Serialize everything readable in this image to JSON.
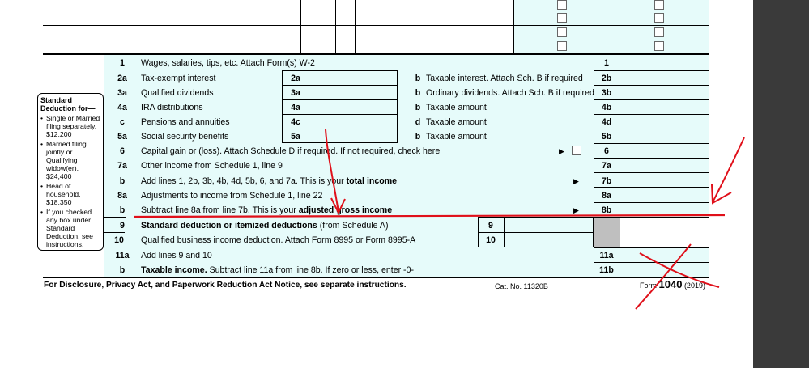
{
  "lines": [
    {
      "num": "1",
      "label": "Wages, salaries, tips, etc. Attach Form(s) W-2",
      "box": "1"
    },
    {
      "num": "2a",
      "label": "Tax-exempt interest",
      "box_mid": "2a",
      "right_prefix": "b",
      "right_label": "Taxable interest. Attach Sch. B if required",
      "box": "2b"
    },
    {
      "num": "3a",
      "label": "Qualified dividends",
      "box_mid": "3a",
      "right_prefix": "b",
      "right_label": "Ordinary dividends. Attach Sch. B if required",
      "box": "3b"
    },
    {
      "num": "4a",
      "label": "IRA distributions",
      "box_mid": "4a",
      "right_prefix": "b",
      "right_label": "Taxable amount",
      "box": "4b"
    },
    {
      "num": "c",
      "label": "Pensions and annuities",
      "box_mid": "4c",
      "right_prefix": "d",
      "right_label": "Taxable amount",
      "box": "4d"
    },
    {
      "num": "5a",
      "label": "Social security benefits",
      "box_mid": "5a",
      "right_prefix": "b",
      "right_label": "Taxable amount",
      "box": "5b"
    },
    {
      "num": "6",
      "label": "Capital gain or (loss). Attach Schedule D if required. If not required, check here",
      "box": "6"
    },
    {
      "num": "7a",
      "label": "Other income from Schedule 1, line 9",
      "box": "7a"
    },
    {
      "num": "b",
      "label_pre": "Add lines 1, 2b, 3b, 4b, 4d, 5b, 6, and 7a. This is your ",
      "label_bold": "total income",
      "box": "7b"
    },
    {
      "num": "8a",
      "label": "Adjustments to income from Schedule 1, line 22",
      "box": "8a"
    },
    {
      "num": "b",
      "label_pre": "Subtract line 8a from line 7b. This is your ",
      "label_bold": "adjusted gross income",
      "box": "8b"
    },
    {
      "num": "9",
      "label_bold": "Standard deduction or itemized deductions",
      "label_post": " (from Schedule A)",
      "box_mid": "9"
    },
    {
      "num": "10",
      "label": "Qualified business income deduction. Attach Form 8995 or Form 8995-A",
      "box_mid": "10"
    },
    {
      "num": "11a",
      "label": "Add lines 9 and 10",
      "box": "11a"
    },
    {
      "num": "b",
      "label_bold": "Taxable income.",
      "label_post": " Subtract line 11a from line 8b. If zero or less, enter -0-",
      "box": "11b"
    }
  ],
  "sidebar": {
    "title": "Standard Deduction for—",
    "items": [
      "Single or Married filing separately, $12,200",
      "Married filing jointly or Qualifying widow(er), $24,400",
      "Head of household, $18,350",
      "If you checked any box under Standard Deduction, see instructions."
    ]
  },
  "footer": {
    "notice": "For Disclosure, Privacy Act, and Paperwork Reduction Act Notice, see separate instructions.",
    "cat": "Cat. No. 11320B",
    "form_prefix": "Form ",
    "form_num": "1040",
    "year": "(2019)"
  },
  "colors": {
    "annotation": "#e0101a",
    "field": "#e6fbfa"
  }
}
